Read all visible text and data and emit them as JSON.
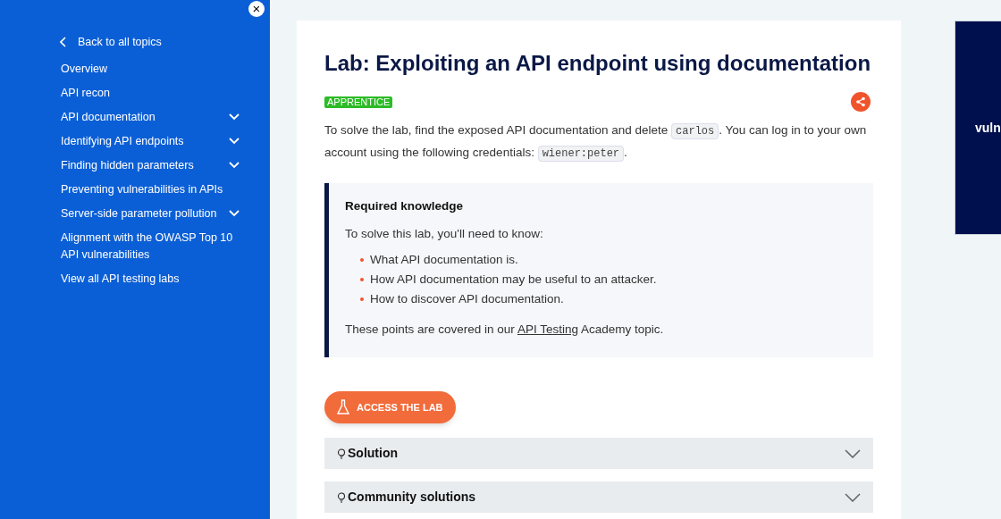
{
  "sidebar": {
    "close": "×",
    "back": "Back to all topics",
    "items": [
      {
        "label": "Overview",
        "expandable": false
      },
      {
        "label": "API recon",
        "expandable": false
      },
      {
        "label": "API documentation",
        "expandable": true
      },
      {
        "label": "Identifying API endpoints",
        "expandable": true
      },
      {
        "label": "Finding hidden parameters",
        "expandable": true
      },
      {
        "label": "Preventing vulnerabilities in APIs",
        "expandable": false
      },
      {
        "label": "Server-side parameter pollution",
        "expandable": true
      },
      {
        "label": "Alignment with the OWASP Top 10 API vulnerabilities",
        "expandable": false
      },
      {
        "label": "View all API testing labs",
        "expandable": false
      }
    ]
  },
  "lab": {
    "title": "Lab: Exploiting an API endpoint using documentation",
    "level": "APPRENTICE",
    "intro": [
      {
        "kind": "text",
        "text": "To solve the lab, find the exposed API documentation and delete "
      },
      {
        "kind": "code",
        "text": "carlos"
      },
      {
        "kind": "text",
        "text": ". You can log in to your own account using the following credentials: "
      },
      {
        "kind": "code",
        "text": "wiener:peter"
      },
      {
        "kind": "text",
        "text": "."
      }
    ],
    "knowledge": {
      "title": "Required knowledge",
      "lead": "To solve this lab, you'll need to know:",
      "points": [
        "What API documentation is.",
        "How API documentation may be useful to an attacker.",
        "How to discover API documentation."
      ],
      "footer": [
        {
          "kind": "text",
          "text": "These points are covered in our "
        },
        {
          "kind": "link",
          "text": "API Testing"
        },
        {
          "kind": "text",
          "text": " Academy topic."
        }
      ]
    },
    "button": "ACCESS THE LAB",
    "sections": [
      {
        "label": "Solution",
        "expanded": false
      },
      {
        "label": "Community solutions",
        "expanded": false
      }
    ]
  },
  "promo": {
    "text": "vuln"
  }
}
